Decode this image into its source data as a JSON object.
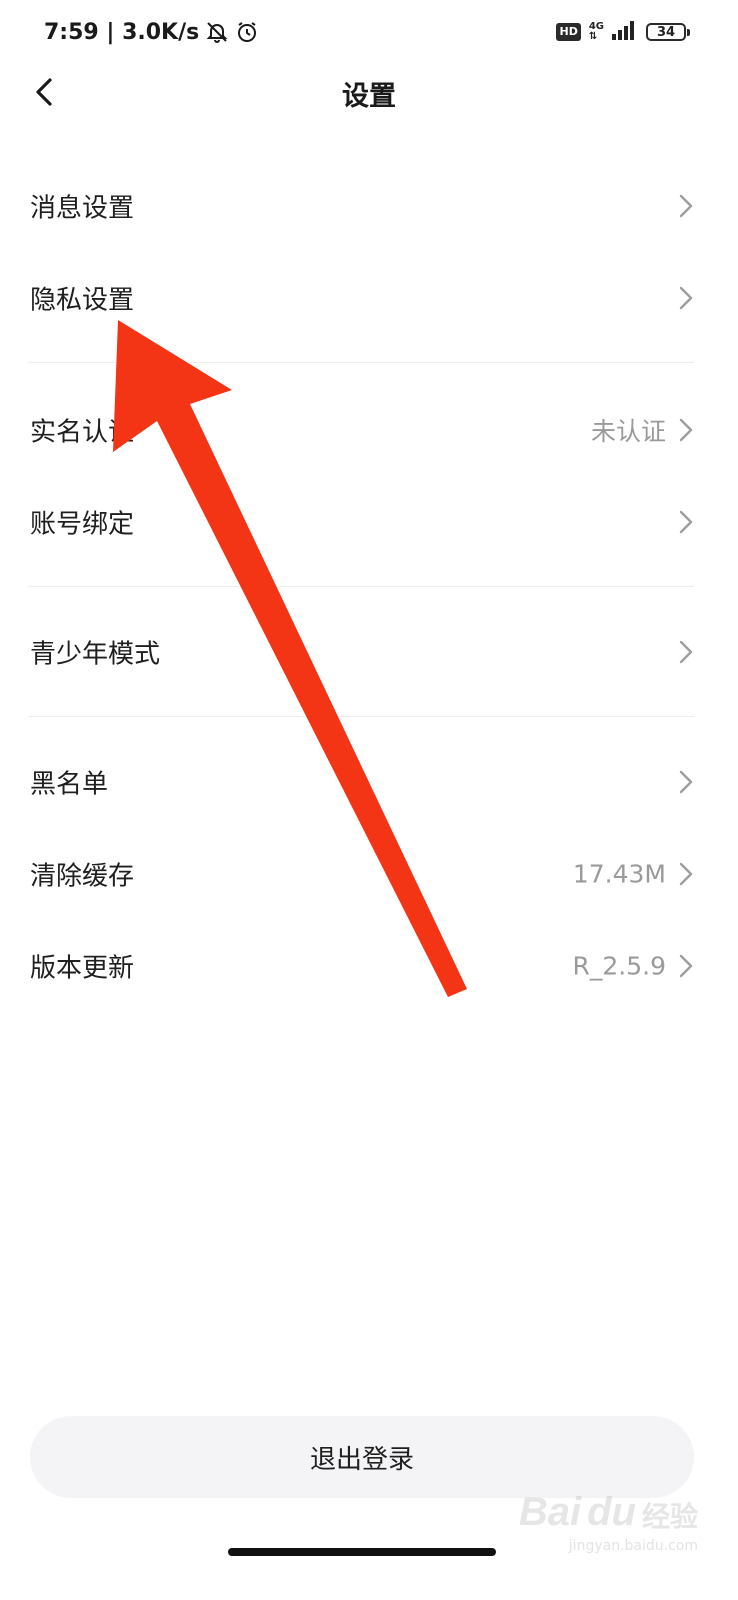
{
  "status_bar": {
    "time_speed": "7:59 | 3.0K/s",
    "hd": "HD",
    "network": "4G",
    "battery": "34",
    "icons": [
      "bell-off-icon",
      "alarm-icon",
      "signal-icon"
    ]
  },
  "header": {
    "title": "设置",
    "back_icon": "chevron-left-icon"
  },
  "settings": [
    {
      "label": "消息设置",
      "value": ""
    },
    {
      "label": "隐私设置",
      "value": ""
    },
    {
      "label": "实名认证",
      "value": "未认证"
    },
    {
      "label": "账号绑定",
      "value": ""
    },
    {
      "label": "青少年模式",
      "value": ""
    },
    {
      "label": "黑名单",
      "value": ""
    },
    {
      "label": "清除缓存",
      "value": "17.43M"
    },
    {
      "label": "版本更新",
      "value": "R_2.5.9"
    }
  ],
  "logout_label": "退出登录",
  "annotation": {
    "arrow_color": "#f33516"
  },
  "watermark": {
    "logo": "Bai",
    "paw": "du",
    "text": "经验",
    "url": "jingyan.baidu.com"
  }
}
